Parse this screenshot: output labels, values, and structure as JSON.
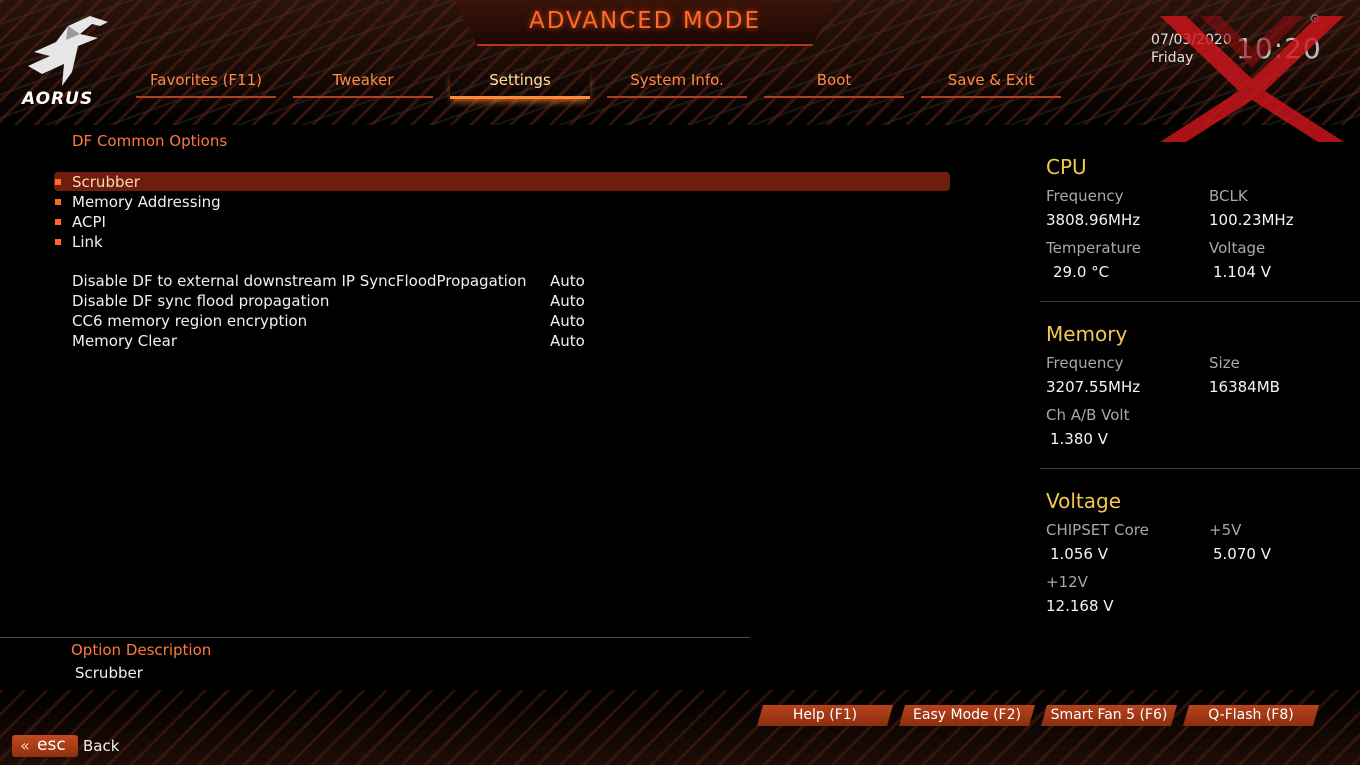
{
  "header": {
    "title": "ADVANCED MODE",
    "logo_text": "AORUS",
    "date": "07/03/2020",
    "day": "Friday",
    "time": "10:20"
  },
  "tabs": [
    {
      "label": "Favorites (F11)",
      "active": false
    },
    {
      "label": "Tweaker",
      "active": false
    },
    {
      "label": "Settings",
      "active": true
    },
    {
      "label": "System Info.",
      "active": false
    },
    {
      "label": "Boot",
      "active": false
    },
    {
      "label": "Save & Exit",
      "active": false
    }
  ],
  "main": {
    "section_title": "DF Common Options",
    "submenus": [
      {
        "label": "Scrubber",
        "selected": true
      },
      {
        "label": "Memory Addressing",
        "selected": false
      },
      {
        "label": "ACPI",
        "selected": false
      },
      {
        "label": "Link",
        "selected": false
      }
    ],
    "options": [
      {
        "name": "Disable DF to external downstream IP SyncFloodPropagation",
        "value": "Auto"
      },
      {
        "name": "Disable DF sync flood propagation",
        "value": "Auto"
      },
      {
        "name": "CC6 memory region encryption",
        "value": "Auto"
      },
      {
        "name": "Memory Clear",
        "value": "Auto"
      }
    ]
  },
  "sidebar": {
    "cpu": {
      "heading": "CPU",
      "frequency_label": "Frequency",
      "frequency": "3808.96MHz",
      "bclk_label": "BCLK",
      "bclk": "100.23MHz",
      "temperature_label": "Temperature",
      "temperature": "29.0 °C",
      "voltage_label": "Voltage",
      "voltage": "1.104 V"
    },
    "memory": {
      "heading": "Memory",
      "frequency_label": "Frequency",
      "frequency": "3207.55MHz",
      "size_label": "Size",
      "size": "16384MB",
      "chab_label": "Ch A/B Volt",
      "chab": "1.380 V"
    },
    "voltage": {
      "heading": "Voltage",
      "chipset_label": "CHIPSET Core",
      "chipset": "1.056 V",
      "p5v_label": "+5V",
      "p5v": "5.070 V",
      "p12v_label": "+12V",
      "p12v": "12.168 V"
    }
  },
  "description": {
    "title": "Option Description",
    "text": "Scrubber"
  },
  "footer": {
    "buttons": [
      "Help (F1)",
      "Easy Mode (F2)",
      "Smart Fan 5 (F6)",
      "Q-Flash (F8)"
    ],
    "esc_label": "esc",
    "back_label": "Back"
  },
  "colors": {
    "accent": "#ff6a2a",
    "selection": "#6e1e0c",
    "sidebar_heading": "#f2c94c"
  }
}
